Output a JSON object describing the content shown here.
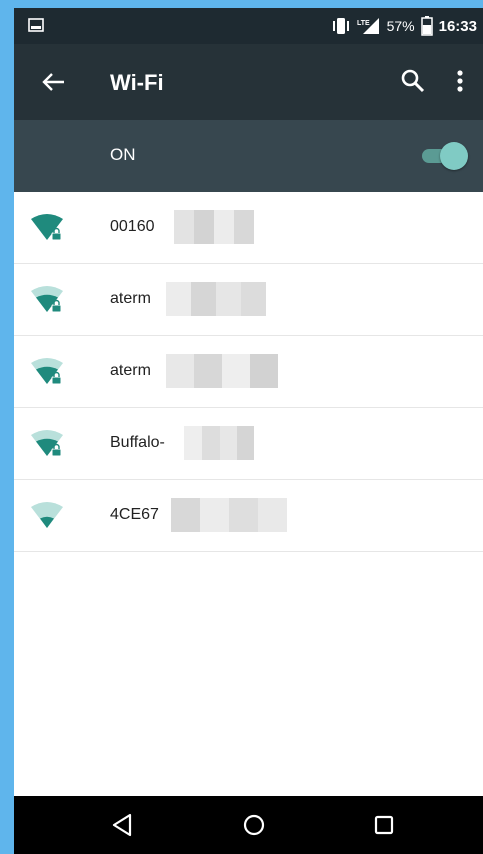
{
  "status_bar": {
    "battery_percent": "57%",
    "time": "16:33",
    "signal_badge": "LTE",
    "icons": [
      "image-notification-icon",
      "vibrate-icon",
      "signal-icon",
      "battery-icon"
    ]
  },
  "app_bar": {
    "title": "Wi-Fi",
    "icons": [
      "back-arrow-icon",
      "search-icon",
      "more-vert-icon"
    ]
  },
  "master_switch": {
    "label": "ON",
    "state": true
  },
  "networks": [
    {
      "ssid": "00160",
      "signal_level": "full",
      "secured": true
    },
    {
      "ssid": "aterm",
      "signal_level": "medium",
      "secured": true
    },
    {
      "ssid": "aterm",
      "signal_level": "medium",
      "secured": true
    },
    {
      "ssid": "Buffalo-",
      "signal_level": "medium",
      "secured": true
    },
    {
      "ssid": "4CE67",
      "signal_level": "low",
      "secured": false
    }
  ],
  "nav_bar": {
    "icons": [
      "back-triangle-icon",
      "home-circle-icon",
      "recents-square-icon"
    ]
  },
  "colors": {
    "status_bar": "#1e2a31",
    "app_bar": "#263238",
    "switch_bar": "#37474f",
    "accent": "#1f8a7d",
    "frame": "#5fb5ec"
  }
}
